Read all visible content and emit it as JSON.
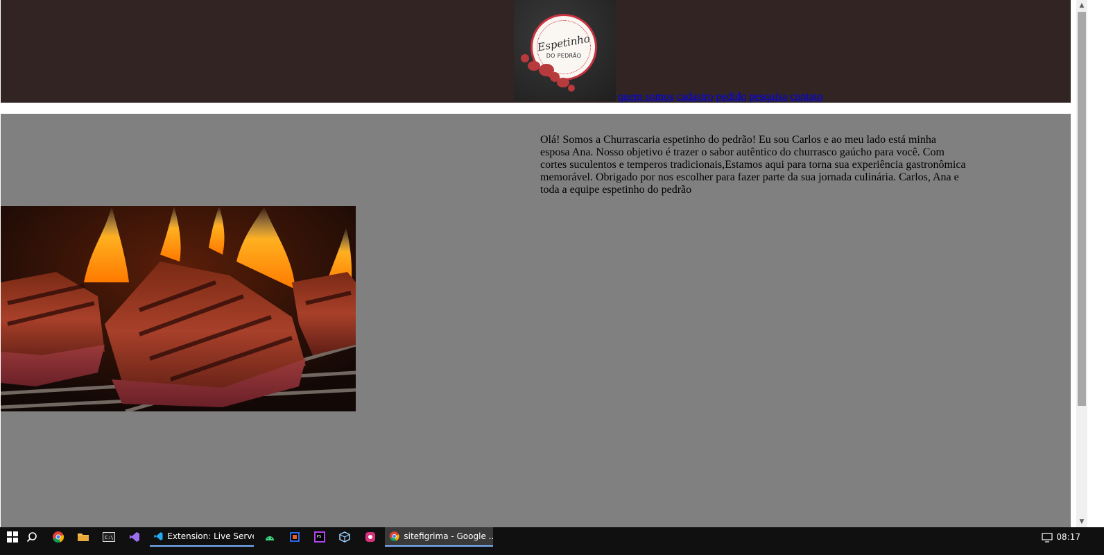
{
  "header": {
    "logo": {
      "alt": "Espetinho do Pedrão logo",
      "script_text": "Espetinho",
      "sub_text": "DO PEDRÃO",
      "icon": "logo-badge"
    },
    "nav": [
      {
        "label": "quem somos",
        "name": "nav-link-quem-somos"
      },
      {
        "label": "cadastro",
        "name": "nav-link-cadastro"
      },
      {
        "label": "pedido",
        "name": "nav-link-pedido"
      },
      {
        "label": "pesquisa",
        "name": "nav-link-pesquisa"
      },
      {
        "label": "contato",
        "name": "nav-link-contato"
      }
    ]
  },
  "main": {
    "intro_text": "Olá! Somos a Churrascaria espetinho do pedrão! Eu sou Carlos e ao meu lado está minha esposa Ana. Nosso objetivo é trazer o sabor autêntico do churrasco gaúcho para você. Com cortes suculentos e temperos tradicionais,Estamos aqui para torna sua experiência gastronômica memorável. Obrigado por nos escolher para fazer parte da sua jornada culinária. Carlos, Ana e toda a equipe espetinho do pedrão",
    "image": {
      "icon": "grilled-steak-photo"
    }
  },
  "taskbar": {
    "apps": [
      {
        "name": "start",
        "icon": "windows-icon"
      },
      {
        "name": "search",
        "icon": "search-icon"
      },
      {
        "name": "chrome",
        "icon": "chrome-icon"
      },
      {
        "name": "file-explorer",
        "icon": "folder-icon"
      },
      {
        "name": "terminal",
        "icon": "terminal-icon"
      },
      {
        "name": "visual-studio",
        "icon": "visual-studio-icon"
      },
      {
        "name": "vscode",
        "icon": "vscode-icon",
        "label": "Extension: Live Server ..."
      },
      {
        "name": "android-studio",
        "icon": "android-icon"
      },
      {
        "name": "app-jb",
        "icon": "jetbrains-icon"
      },
      {
        "name": "phpstorm",
        "icon": "phpstorm-icon"
      },
      {
        "name": "virtualbox",
        "icon": "virtualbox-icon"
      },
      {
        "name": "app-pink",
        "icon": "app-icon"
      },
      {
        "name": "chrome-window",
        "icon": "chrome-icon",
        "label": "sitefigrima - Google ..."
      }
    ],
    "clock": "08:17"
  },
  "colors": {
    "header_bg": "#332424",
    "main_bg": "#808080",
    "link": "#0000ee",
    "taskbar_bg": "#101010"
  }
}
